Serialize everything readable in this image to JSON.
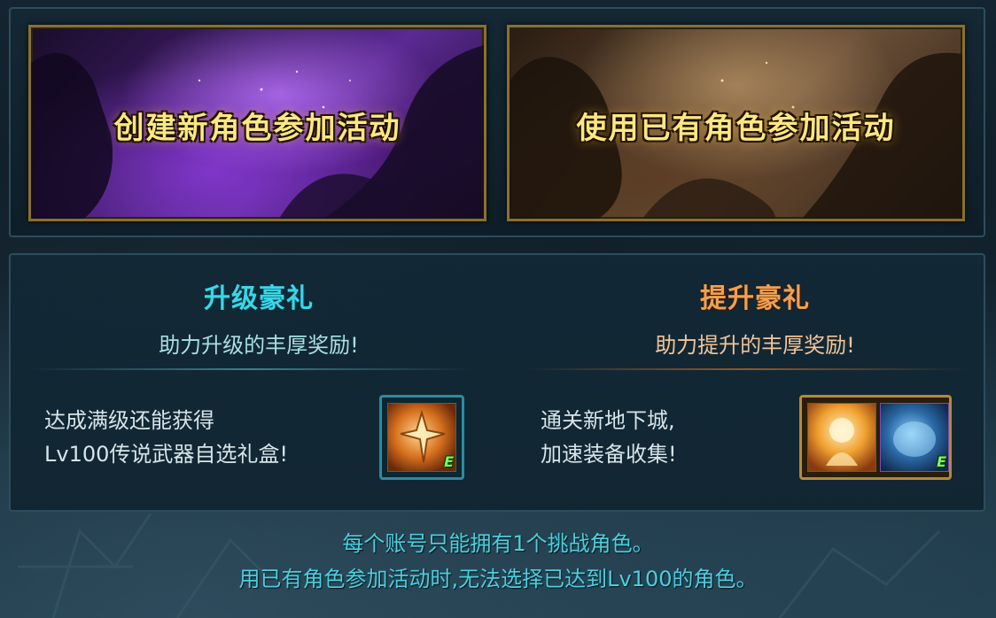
{
  "banners": {
    "create_new": "创建新角色参加活动",
    "use_existing": "使用已有角色参加活动"
  },
  "rewards": {
    "left": {
      "title": "升级豪礼",
      "subtitle": "助力升级的丰厚奖励!",
      "text_line1": "达成满级还能获得",
      "text_line2": "Lv100传说武器自选礼盒!",
      "items": [
        {
          "icon": "weapon-box-icon",
          "badge": "E"
        }
      ]
    },
    "right": {
      "title": "提升豪礼",
      "subtitle": "助力提升的丰厚奖励!",
      "text_line1": "通关新地下城,",
      "text_line2": "加速装备收集!",
      "items": [
        {
          "icon": "gold-box-icon",
          "badge": ""
        },
        {
          "icon": "blue-orb-icon",
          "badge": "E"
        }
      ]
    }
  },
  "notes": {
    "line1": "每个账号只能拥有1个挑战角色。",
    "line2": "用已有角色参加活动时,无法选择已达到Lv100的角色。"
  },
  "colors": {
    "accent_cyan": "#39d7e8",
    "accent_orange": "#f0a050",
    "banner_gold": "#ffe680",
    "frame_gold": "#8a7030"
  }
}
